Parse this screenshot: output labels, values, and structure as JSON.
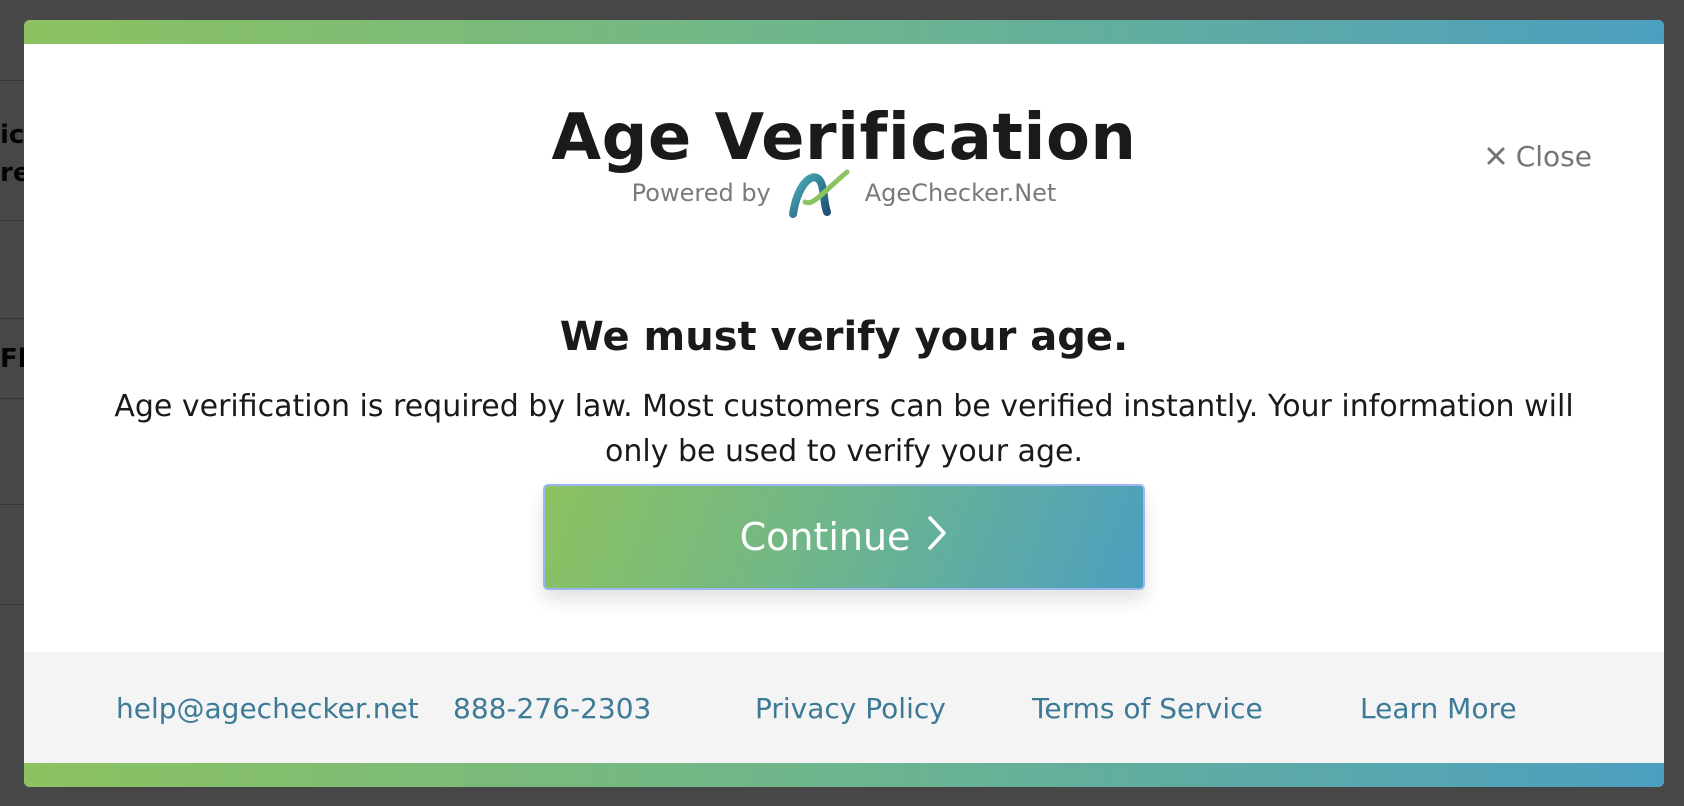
{
  "background": {
    "fragments": [
      "ick",
      "re",
      "Fl"
    ]
  },
  "modal": {
    "title": "Age Verification",
    "powered_by_label": "Powered by",
    "brand_name": "AgeChecker.Net",
    "close_label": "Close",
    "heading": "We must verify your age.",
    "description": "Age verification is required by law. Most customers can be verified instantly. Your information will only be used to verify your age.",
    "continue_label": "Continue"
  },
  "footer": {
    "links": [
      {
        "label": "help@agechecker.net"
      },
      {
        "label": "888-276-2303"
      },
      {
        "label": "Privacy Policy"
      },
      {
        "label": "Terms of Service"
      },
      {
        "label": "Learn More"
      }
    ]
  },
  "colors": {
    "gradient_start": "#8cc260",
    "gradient_end": "#4c9fc0",
    "link": "#3c7a96"
  },
  "icons": {
    "close": "x-icon",
    "continue": "chevron-right-icon",
    "brand": "agechecker-logo"
  }
}
